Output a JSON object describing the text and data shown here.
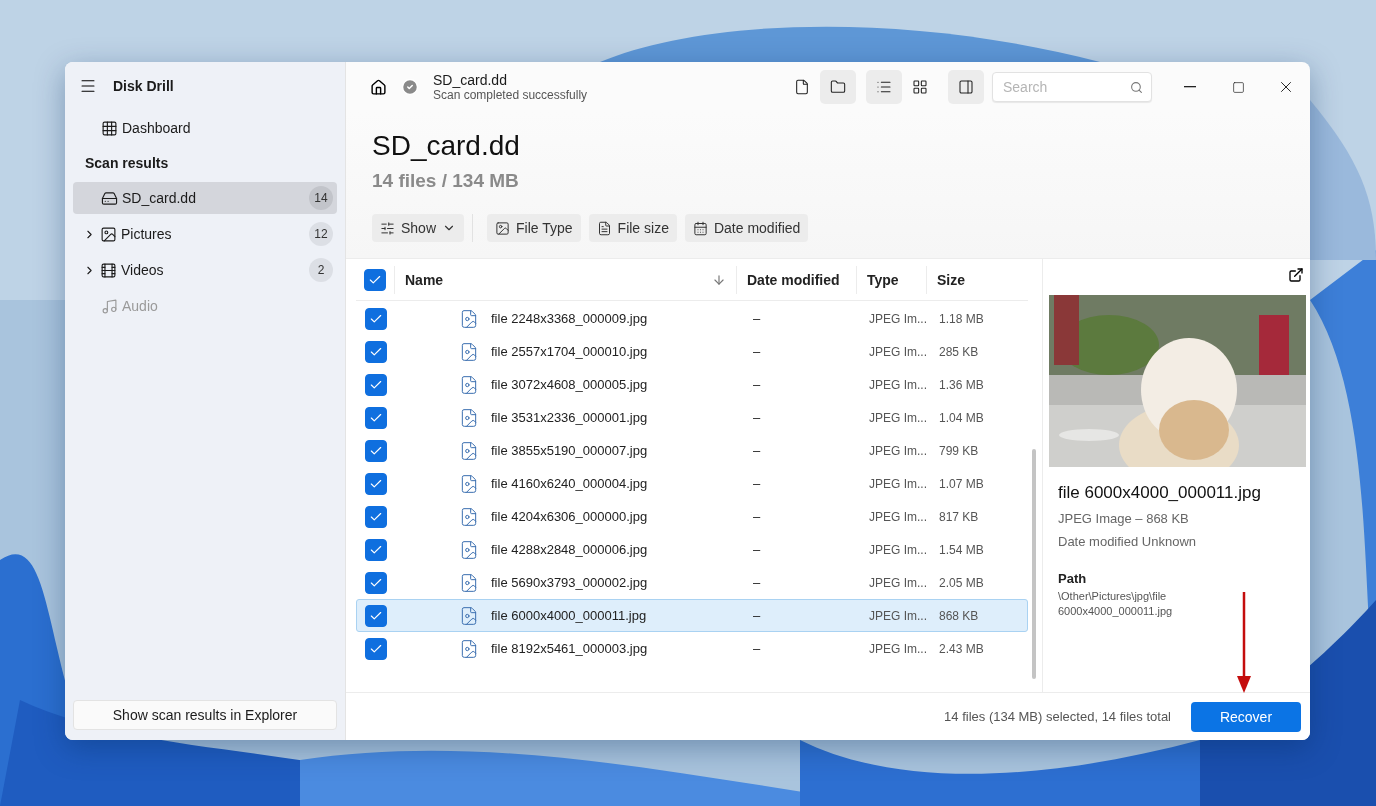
{
  "sidebar": {
    "app_title": "Disk Drill",
    "items": [
      {
        "kind": "dashboard",
        "label": "Dashboard",
        "selected": false,
        "disabled": false
      },
      {
        "kind": "section",
        "label": "Scan results"
      },
      {
        "kind": "drive",
        "label": "SD_card.dd",
        "count": "14",
        "selected": true,
        "disabled": false
      },
      {
        "kind": "pictures",
        "label": "Pictures",
        "count": "12",
        "selected": false,
        "disabled": false,
        "expanded": false
      },
      {
        "kind": "videos",
        "label": "Videos",
        "count": "2",
        "selected": false,
        "disabled": false,
        "expanded": false
      },
      {
        "kind": "audio",
        "label": "Audio",
        "selected": false,
        "disabled": true
      }
    ],
    "footer_button": "Show scan results in Explorer"
  },
  "topbar": {
    "title": "SD_card.dd",
    "status": "Scan completed successfully",
    "view_buttons": [
      {
        "kind": "file",
        "selected": false
      },
      {
        "kind": "folder",
        "selected": true
      },
      {
        "kind": "list",
        "selected": true
      },
      {
        "kind": "grid",
        "selected": false
      },
      {
        "kind": "preview",
        "selected": true
      }
    ],
    "search": {
      "placeholder": "Search"
    }
  },
  "header": {
    "title": "SD_card.dd",
    "subtitle": "14 files / 134 MB",
    "filters": [
      {
        "kind": "show",
        "label": "Show"
      },
      {
        "kind": "type",
        "label": "File Type"
      },
      {
        "kind": "size",
        "label": "File size"
      },
      {
        "kind": "date",
        "label": "Date modified"
      }
    ]
  },
  "table": {
    "all_checked": true,
    "columns": [
      "Name",
      "Date modified",
      "Type",
      "Size"
    ],
    "rows": [
      {
        "name": "file 2248x3368_000009.jpg",
        "date": "–",
        "type": "JPEG Im...",
        "size": "1.18 MB",
        "checked": true,
        "selected": false
      },
      {
        "name": "file 2557x1704_000010.jpg",
        "date": "–",
        "type": "JPEG Im...",
        "size": "285 KB",
        "checked": true,
        "selected": false
      },
      {
        "name": "file 3072x4608_000005.jpg",
        "date": "–",
        "type": "JPEG Im...",
        "size": "1.36 MB",
        "checked": true,
        "selected": false
      },
      {
        "name": "file 3531x2336_000001.jpg",
        "date": "–",
        "type": "JPEG Im...",
        "size": "1.04 MB",
        "checked": true,
        "selected": false
      },
      {
        "name": "file 3855x5190_000007.jpg",
        "date": "–",
        "type": "JPEG Im...",
        "size": "799 KB",
        "checked": true,
        "selected": false
      },
      {
        "name": "file 4160x6240_000004.jpg",
        "date": "–",
        "type": "JPEG Im...",
        "size": "1.07 MB",
        "checked": true,
        "selected": false
      },
      {
        "name": "file 4204x6306_000000.jpg",
        "date": "–",
        "type": "JPEG Im...",
        "size": "817 KB",
        "checked": true,
        "selected": false
      },
      {
        "name": "file 4288x2848_000006.jpg",
        "date": "–",
        "type": "JPEG Im...",
        "size": "1.54 MB",
        "checked": true,
        "selected": false
      },
      {
        "name": "file 5690x3793_000002.jpg",
        "date": "–",
        "type": "JPEG Im...",
        "size": "2.05 MB",
        "checked": true,
        "selected": false
      },
      {
        "name": "file 6000x4000_000011.jpg",
        "date": "–",
        "type": "JPEG Im...",
        "size": "868 KB",
        "checked": true,
        "selected": true
      },
      {
        "name": "file 8192x5461_000003.jpg",
        "date": "–",
        "type": "JPEG Im...",
        "size": "2.43 MB",
        "checked": true,
        "selected": false
      }
    ]
  },
  "preview": {
    "kind": "picture",
    "file_name": "file 6000x4000_000011.jpg",
    "details": "JPEG Image – 868 KB",
    "date": "Date modified Unknown",
    "path_label": "Path",
    "path": "\\Other\\Pictures\\jpg\\file 6000x4000_000011.jpg"
  },
  "footer": {
    "summary": "14 files (134 MB) selected, 14 files total",
    "button": "Recover"
  }
}
